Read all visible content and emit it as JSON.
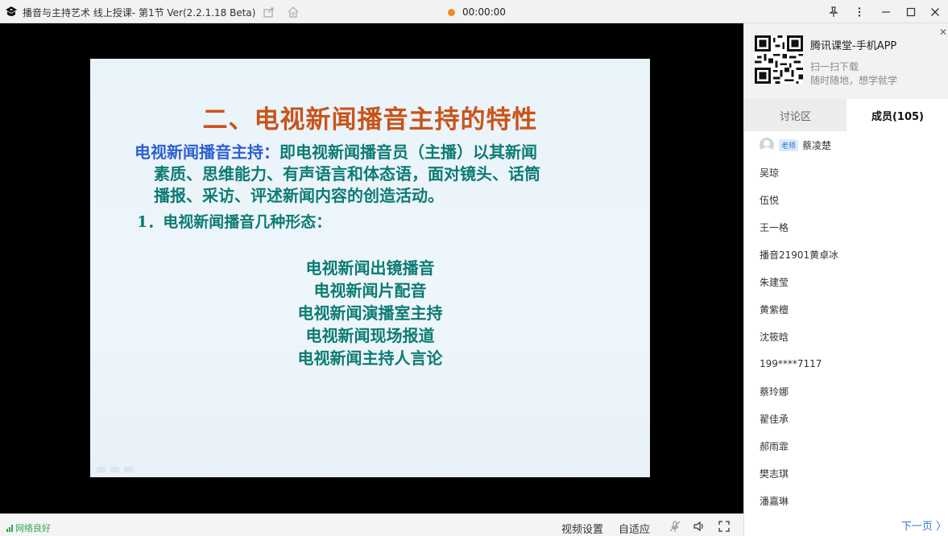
{
  "window": {
    "title": "播音与主持艺术 线上授课- 第1节 Ver(2.2.1.18 Beta)",
    "timer": "00:00:00",
    "timer_color": "#f08a24"
  },
  "slide": {
    "title": "二、电视新闻播音主持的特性",
    "term": "电视新闻播音主持：",
    "definition_line1": "即电视新闻播音员（主播）以其新闻",
    "definition_line2": "素质、思维能力、有声语言和体态语，面对镜头、话筒",
    "definition_line3": "播报、采访、评述新闻内容的创造活动。",
    "subheading": "1．电视新闻播音几种形态：",
    "forms": [
      "电视新闻出镜播音",
      "电视新闻片配音",
      "电视新闻演播室主持",
      "电视新闻现场报道",
      "电视新闻主持人言论"
    ]
  },
  "bottombar": {
    "network": "网络良好",
    "video_settings": "视频设置",
    "fit": "自适应"
  },
  "panel": {
    "promo_title": "腾讯课堂-手机APP",
    "promo_line1": "扫一扫下载",
    "promo_line2": "随时随地，想学就学",
    "tab_discussion": "讨论区",
    "tab_members": "成员(105)",
    "teacher_badge": "老师",
    "teacher_name": "蔡凌楚",
    "members": [
      "吴琼",
      "伍悦",
      "王一格",
      "播音21901黄卓冰",
      "朱建莹",
      "黄紫檀",
      "沈筱晗",
      "199****7117",
      "蔡玲娜",
      "翟佳承",
      "郝雨霏",
      "樊志琪",
      "潘嘉琳"
    ],
    "next_page": "下一页"
  }
}
